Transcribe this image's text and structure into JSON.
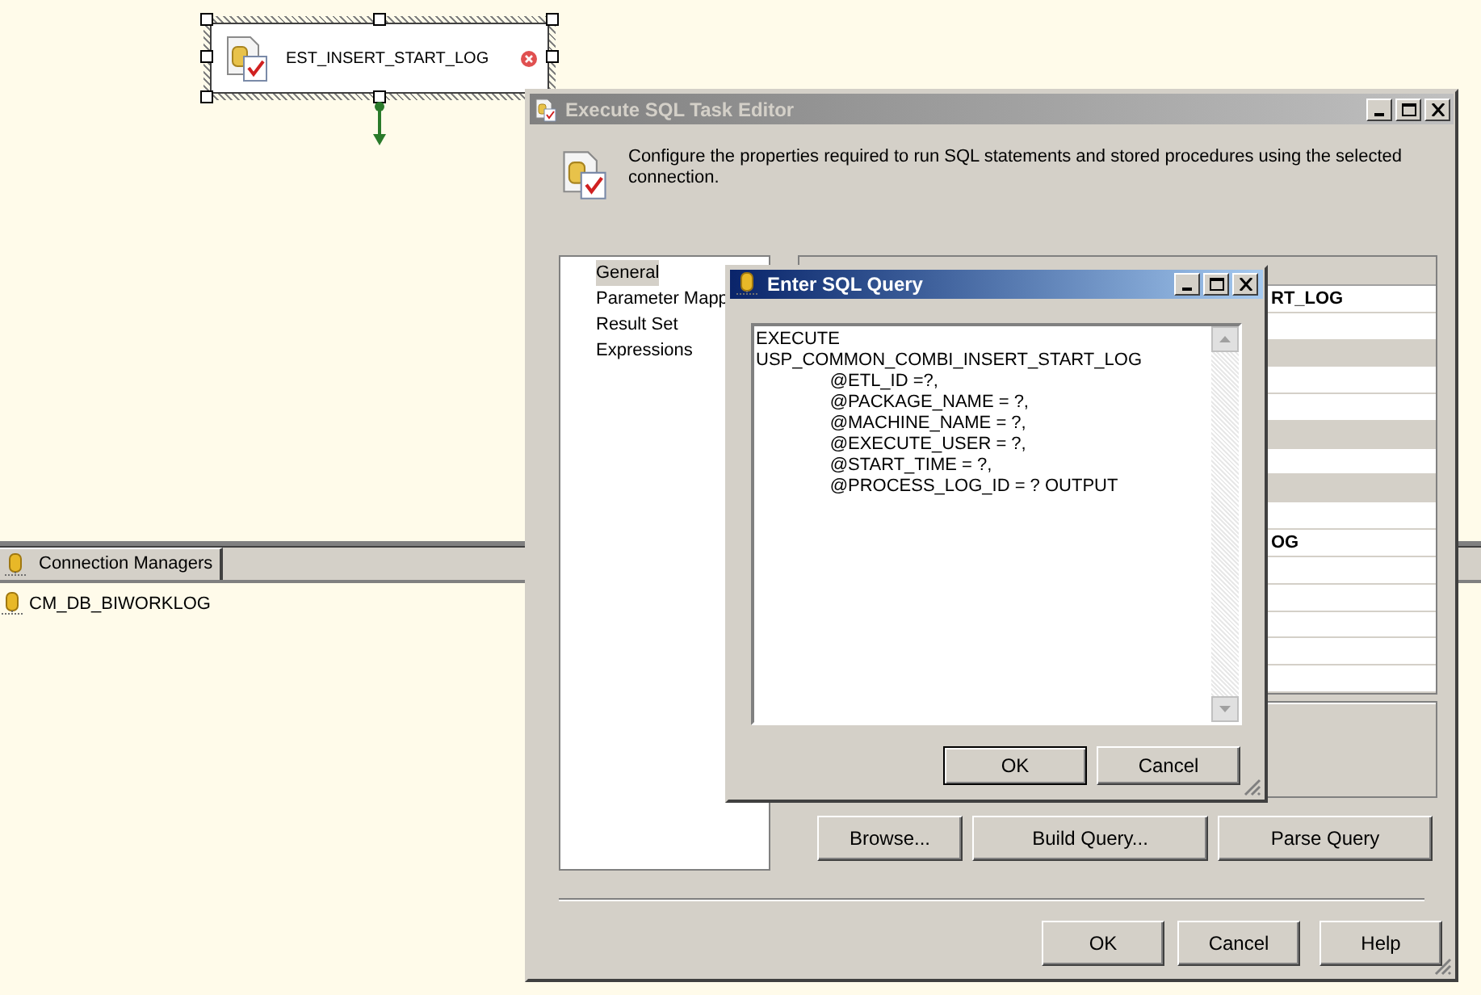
{
  "designer": {
    "task": {
      "name": "EST_INSERT_START_LOG",
      "selected": true,
      "error": true
    }
  },
  "connection_managers": {
    "tab": "Connection Managers",
    "items": [
      "CM_DB_BIWORKLOG"
    ]
  },
  "editor": {
    "title": "Execute SQL Task Editor",
    "active": false,
    "description": "Configure the properties required to run SQL statements and stored procedures using the selected connection.",
    "nav": [
      {
        "label": "General",
        "selected": true
      },
      {
        "label": "Parameter Mapp",
        "selected": false
      },
      {
        "label": "Result Set",
        "selected": false
      },
      {
        "label": "Expressions",
        "selected": false
      }
    ],
    "grid_rows": [
      {
        "kind": "property",
        "value": "RT_LOG"
      },
      {
        "kind": "property"
      },
      {
        "kind": "category"
      },
      {
        "kind": "property"
      },
      {
        "kind": "property"
      },
      {
        "kind": "category"
      },
      {
        "kind": "property"
      },
      {
        "kind": "category"
      },
      {
        "kind": "property"
      },
      {
        "kind": "property",
        "value": "OG"
      },
      {
        "kind": "property"
      },
      {
        "kind": "property"
      },
      {
        "kind": "property"
      },
      {
        "kind": "property"
      },
      {
        "kind": "property"
      }
    ],
    "buttons": [
      "Browse...",
      "Build Query...",
      "Parse Query"
    ],
    "footer_buttons": [
      "OK",
      "Cancel",
      "Help"
    ]
  },
  "query_dialog": {
    "title": "Enter SQL Query",
    "active": true,
    "query": "EXECUTE\nUSP_COMMON_COMBI_INSERT_START_LOG\n\t@ETL_ID =?,\n\t@PACKAGE_NAME = ?,\n\t@MACHINE_NAME = ?,\n\t@EXECUTE_USER = ?,\n\t@START_TIME = ?,\n\t@PROCESS_LOG_ID = ? OUTPUT",
    "buttons": [
      {
        "label": "OK",
        "default": true
      },
      {
        "label": "Cancel",
        "default": false
      }
    ]
  }
}
